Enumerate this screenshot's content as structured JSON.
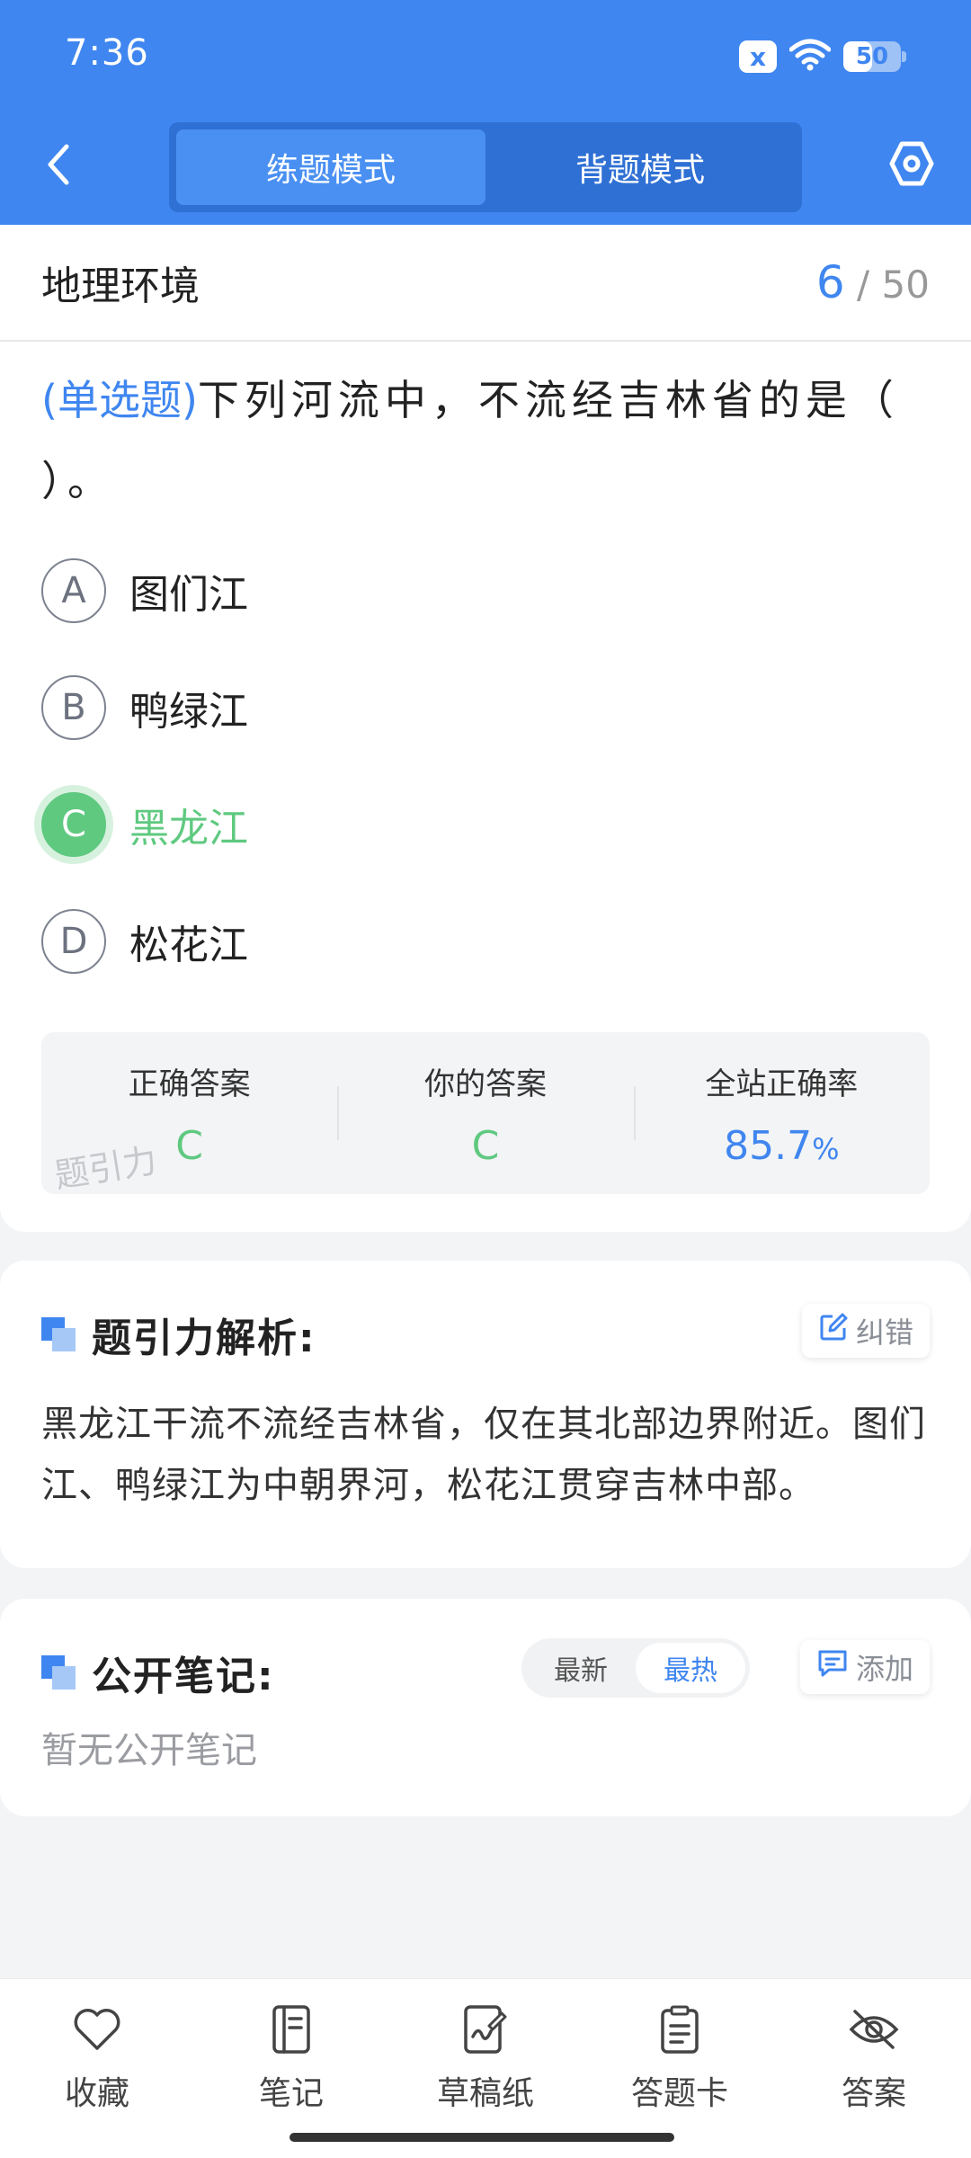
{
  "status": {
    "time": "7:36",
    "battery": "50",
    "battery_level": 0.5,
    "notif_icon": "x"
  },
  "header": {
    "tabs": [
      {
        "label": "练题模式",
        "active": true
      },
      {
        "label": "背题模式",
        "active": false
      }
    ],
    "accent": "#3f86f0"
  },
  "section": {
    "title": "地理环境",
    "current": "6",
    "separator": "/",
    "total": "50"
  },
  "question": {
    "type_label": "(单选题)",
    "text": "下列河流中，不流经吉林省的是（ ）。",
    "options": [
      {
        "letter": "A",
        "text": "图们江",
        "correct": false
      },
      {
        "letter": "B",
        "text": "鸭绿江",
        "correct": false
      },
      {
        "letter": "C",
        "text": "黑龙江",
        "correct": true
      },
      {
        "letter": "D",
        "text": "松花江",
        "correct": false
      }
    ]
  },
  "answer_summary": {
    "correct_label": "正确答案",
    "correct_value": "C",
    "yours_label": "你的答案",
    "yours_value": "C",
    "rate_label": "全站正确率",
    "rate_value": "85.7",
    "rate_unit": "%",
    "watermark": "题引力"
  },
  "analysis": {
    "title": "题引力解析:",
    "report_label": "纠错",
    "text": "黑龙江干流不流经吉林省，仅在其北部边界附近。图们江、鸭绿江为中朝界河，松花江贯穿吉林中部。"
  },
  "notes": {
    "title": "公开笔记:",
    "sort_tabs": [
      {
        "label": "最新",
        "active": false
      },
      {
        "label": "最热",
        "active": true
      }
    ],
    "add_label": "添加",
    "empty_text": "暂无公开笔记"
  },
  "bottom_bar": [
    {
      "label": "收藏",
      "icon": "heart-icon"
    },
    {
      "label": "笔记",
      "icon": "notebook-icon"
    },
    {
      "label": "草稿纸",
      "icon": "draft-icon"
    },
    {
      "label": "答题卡",
      "icon": "clipboard-icon"
    },
    {
      "label": "答案",
      "icon": "eye-off-icon"
    }
  ]
}
